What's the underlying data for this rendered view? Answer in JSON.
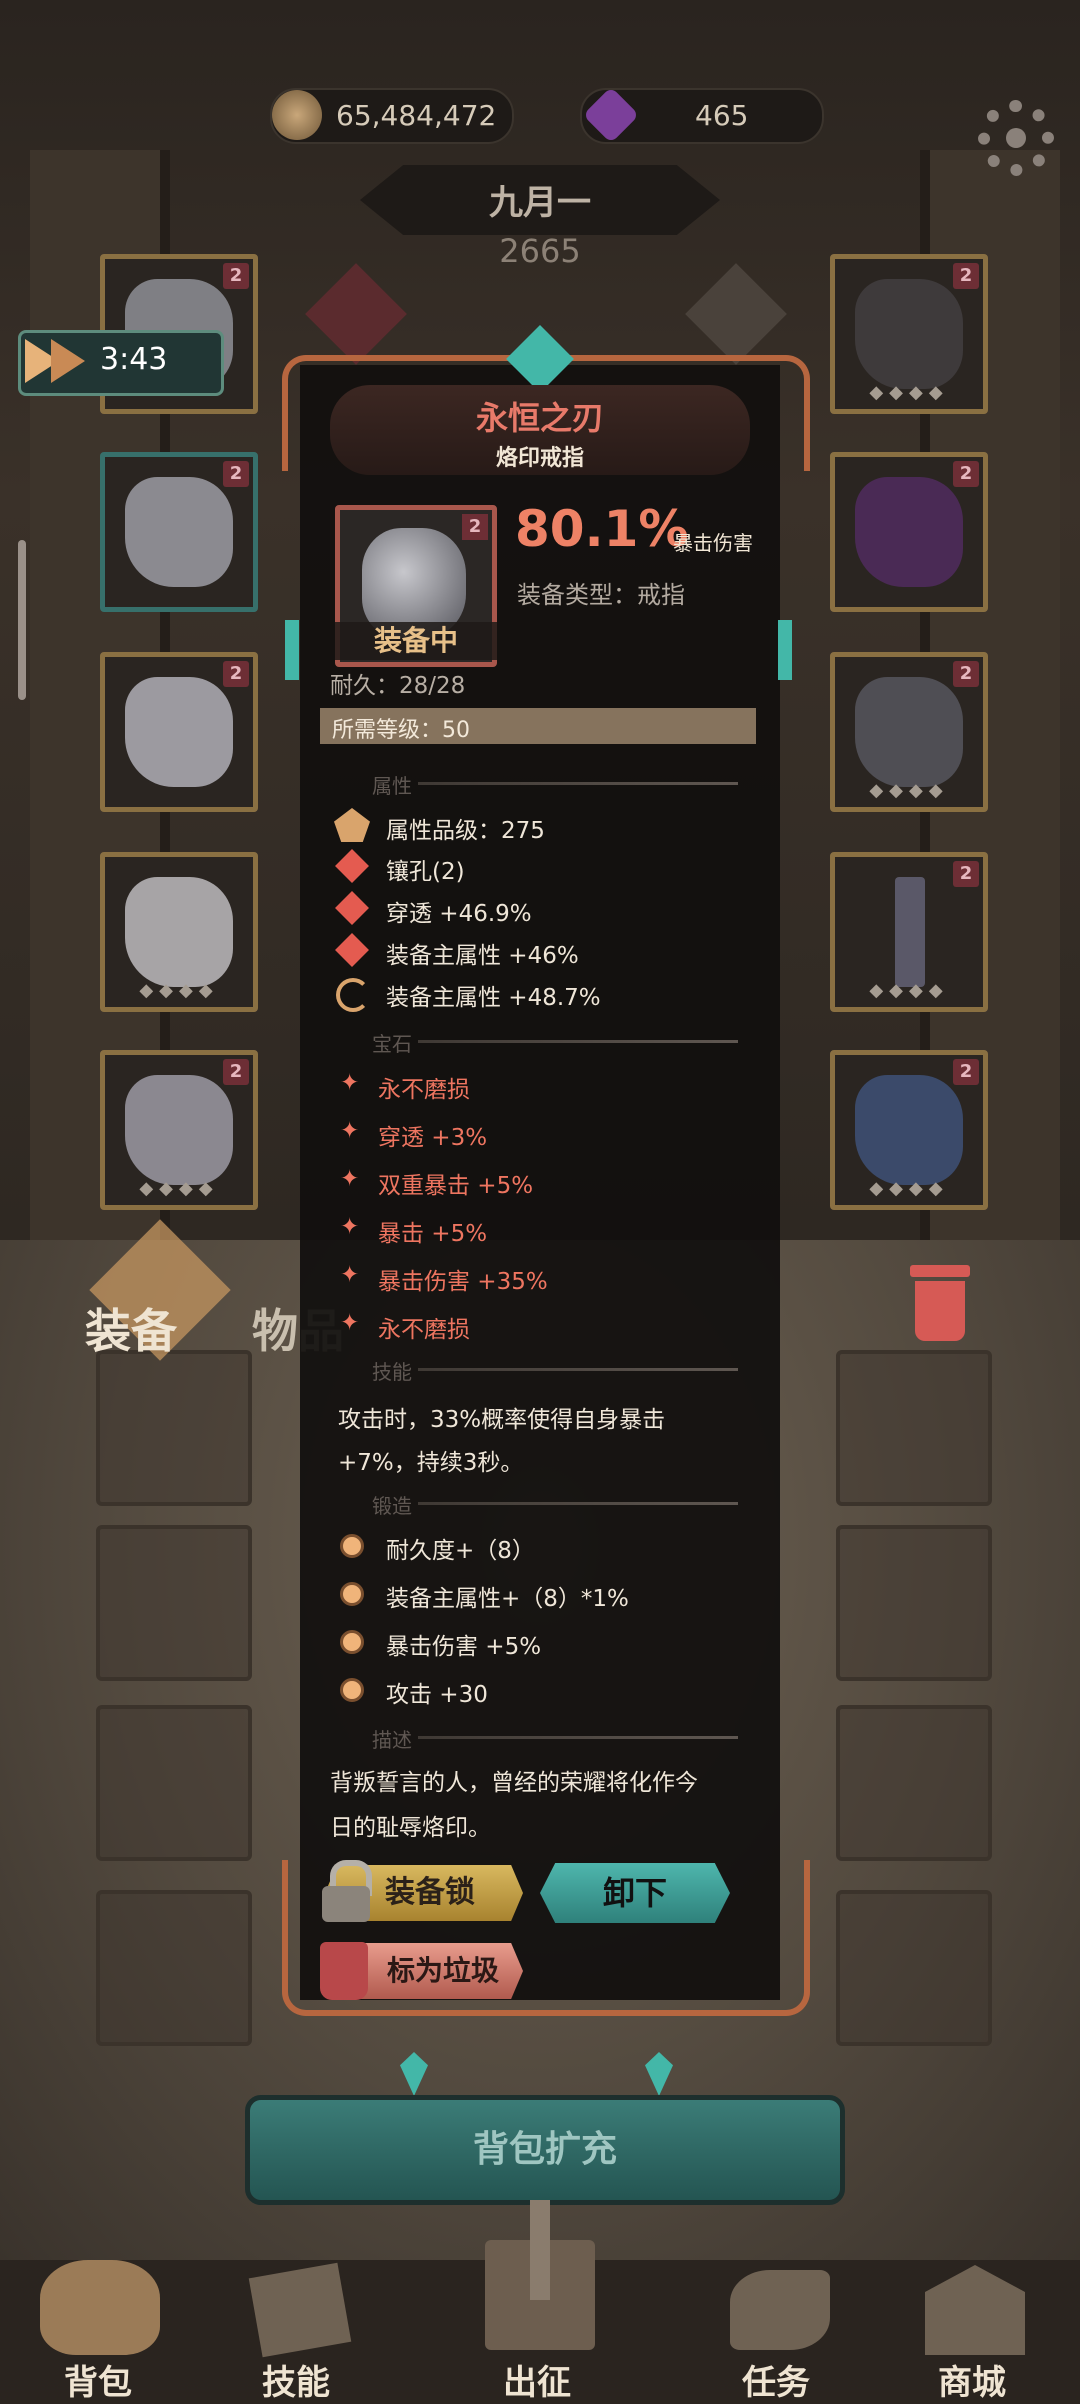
{
  "currency": {
    "gold": "65,484,472",
    "gems": "465"
  },
  "player": {
    "name": "九月一",
    "power": "2665"
  },
  "timer": "3:43",
  "slot_badge": "2",
  "slot_gems": "◆◆◆◆",
  "item": {
    "name": "永恒之刃",
    "type_label": "烙印戒指",
    "stat_value": "80.1%",
    "stat_label": "暴击伤害",
    "equip_type": "装备类型：戒指",
    "equipped_tag": "装备中",
    "durability": "耐久：28/28",
    "required_level": "所需等级：50"
  },
  "sections": {
    "attributes": "属性",
    "gems": "宝石",
    "skills": "技能",
    "forge": "锻造",
    "description": "描述"
  },
  "attributes": [
    "属性品级：275",
    "镶孔(2)",
    "穿透 +46.9%",
    "装备主属性 +46%",
    "装备主属性 +48.7%"
  ],
  "gem_effects": [
    "永不磨损",
    "穿透 +3%",
    "双重暴击 +5%",
    "暴击 +5%",
    "暴击伤害 +35%",
    "永不磨损"
  ],
  "skill_lines": [
    "攻击时，33%概率使得自身暴击",
    "+7%，持续3秒。"
  ],
  "forge": [
    "耐久度+（8）",
    "装备主属性+（8）*1%",
    "暴击伤害 +5%",
    "攻击 +30"
  ],
  "description_lines": [
    "背叛誓言的人，曾经的荣耀将化作今",
    "日的耻辱烙印。"
  ],
  "buttons": {
    "lock": "装备锁",
    "unequip": "卸下",
    "junk": "标为垃圾",
    "expand": "背包扩充"
  },
  "bag_tabs": {
    "equipment": "装备",
    "items": "物品"
  },
  "nav": {
    "bag": "背包",
    "skills": "技能",
    "battle": "出征",
    "quest": "任务",
    "shop": "商城"
  },
  "colors": {
    "accent_red": "#ee7560",
    "gold": "#e7b37a",
    "teal": "#3a8f86"
  }
}
